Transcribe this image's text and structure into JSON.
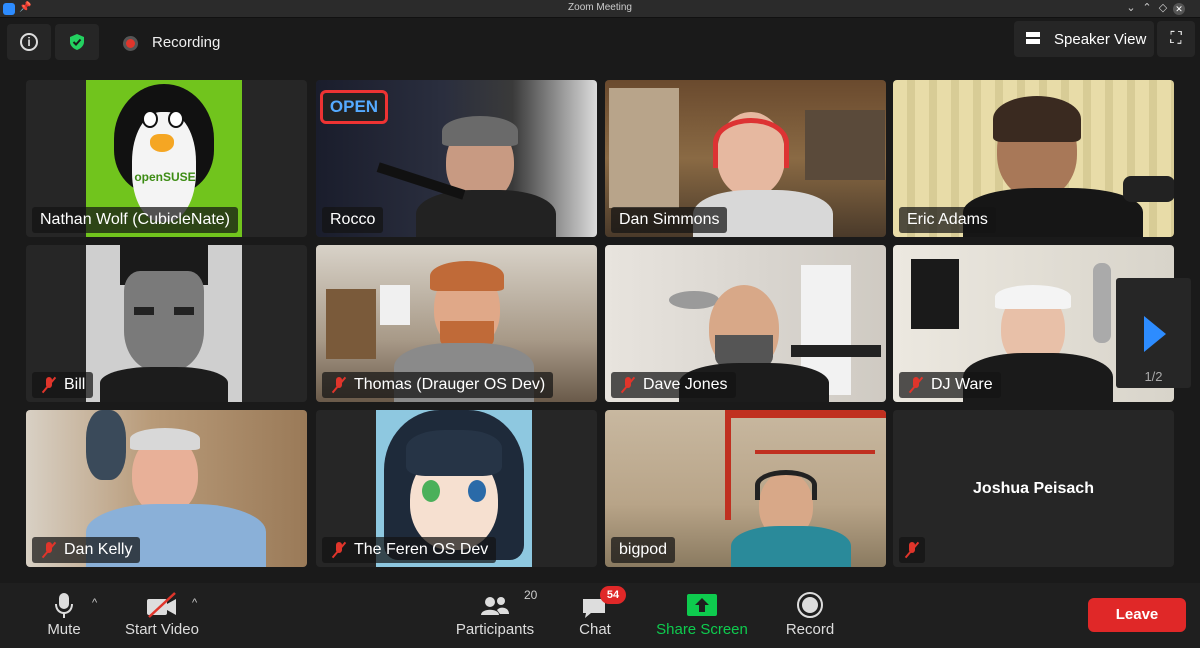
{
  "window": {
    "title": "Zoom Meeting"
  },
  "topbar": {
    "recording_label": "Recording",
    "speaker_view_label": "Speaker View"
  },
  "participants": [
    {
      "name": "Nathan Wolf (CubicleNate)",
      "muted": false
    },
    {
      "name": "Rocco",
      "muted": false
    },
    {
      "name": "Dan Simmons",
      "muted": false
    },
    {
      "name": "Eric Adams",
      "muted": false
    },
    {
      "name": "Bill",
      "muted": true
    },
    {
      "name": "Thomas (Drauger OS Dev)",
      "muted": true
    },
    {
      "name": "Dave Jones",
      "muted": true
    },
    {
      "name": "DJ Ware",
      "muted": true
    },
    {
      "name": "Dan Kelly",
      "muted": true
    },
    {
      "name": "The Feren OS Dev",
      "muted": true
    },
    {
      "name": "bigpod",
      "muted": false
    },
    {
      "name": "Joshua Peisach",
      "muted": true
    }
  ],
  "avatar_text": {
    "suse_text": "openSUSE",
    "open_sign": "OPEN"
  },
  "pagination": {
    "label": "1/2"
  },
  "toolbar": {
    "mute_label": "Mute",
    "start_video_label": "Start Video",
    "participants_label": "Participants",
    "participants_count": "20",
    "chat_label": "Chat",
    "chat_badge": "54",
    "share_label": "Share Screen",
    "record_label": "Record",
    "leave_label": "Leave"
  },
  "colors": {
    "accent_blue": "#2d8cff",
    "leave_red": "#e02828",
    "share_green": "#0ecb4e",
    "tile_bg": "#262626"
  }
}
